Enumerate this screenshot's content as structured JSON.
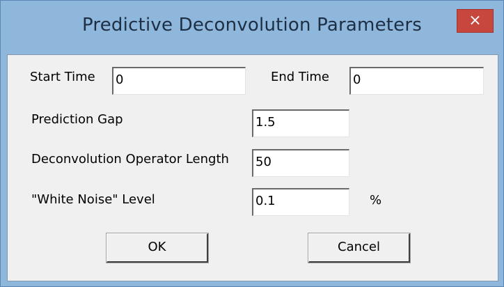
{
  "window": {
    "title": "Predictive Deconvolution Parameters",
    "close_glyph": "×"
  },
  "fields": {
    "start_time": {
      "label": "Start Time",
      "value": "0"
    },
    "end_time": {
      "label": "End Time",
      "value": "0"
    },
    "prediction_gap": {
      "label": "Prediction Gap",
      "value": "1.5"
    },
    "operator_length": {
      "label": "Deconvolution Operator Length",
      "value": "50"
    },
    "white_noise": {
      "label": "\"White Noise\" Level",
      "value": "0.1",
      "unit": "%"
    }
  },
  "buttons": {
    "ok": "OK",
    "cancel": "Cancel"
  },
  "icons": {
    "close": "close-icon"
  },
  "colors": {
    "title_bar": "#8fb7dc",
    "close_button": "#c7463e",
    "dialog_body": "#f0f0f0"
  }
}
